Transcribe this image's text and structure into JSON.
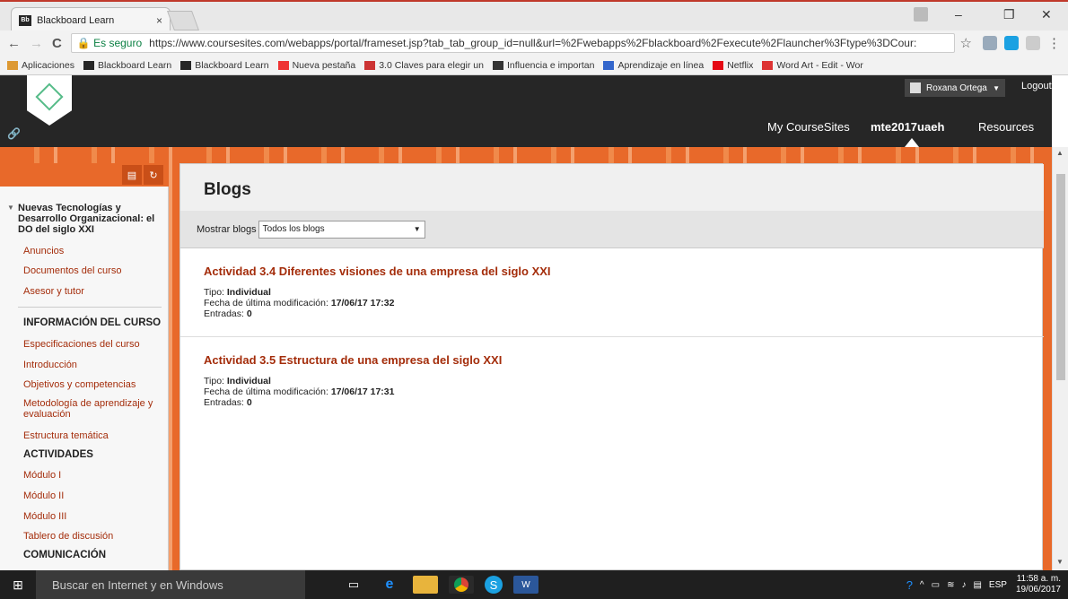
{
  "browser": {
    "tab_title": "Blackboard Learn",
    "tab_favicon": "Bb",
    "tab_close": "×",
    "minimize": "–",
    "maximize": "❐",
    "close": "✕",
    "back": "←",
    "forward": "→",
    "reload": "C",
    "secure_label": "🔒 Es seguro",
    "url": "https://www.coursesites.com/webapps/portal/frameset.jsp?tab_tab_group_id=null&url=%2Fwebapps%2Fblackboard%2Fexecute%2Flauncher%3Ftype%3DCour:",
    "star": "☆",
    "menu": "⋮"
  },
  "bookmarks": [
    {
      "label": "Aplicaciones",
      "color": "#d93"
    },
    {
      "label": "Blackboard Learn",
      "color": "#262626"
    },
    {
      "label": "Blackboard Learn",
      "color": "#262626"
    },
    {
      "label": "Nueva pestaña",
      "color": "#e33"
    },
    {
      "label": "3.0 Claves para elegir un",
      "color": "#c33"
    },
    {
      "label": "Influencia e importan",
      "color": "#333"
    },
    {
      "label": "Aprendizaje en línea",
      "color": "#36c"
    },
    {
      "label": "Netflix",
      "color": "#e50914"
    },
    {
      "label": "Word Art - Edit - Wor",
      "color": "#d33"
    }
  ],
  "header": {
    "user_name": "Roxana Ortega",
    "logout": "Logout",
    "link_icon": "🔗",
    "nav": {
      "my_coursesites": "My CourseSites",
      "course": "mte2017uaeh",
      "resources": "Resources"
    }
  },
  "sidebar": {
    "course_title": "Nuevas Tecnologías y Desarrollo Organizacional: el DO del siglo XXI",
    "caret": "▼",
    "links_top": [
      "Anuncios",
      "Documentos del curso",
      "Asesor y tutor"
    ],
    "section_info": "INFORMACIÓN DEL CURSO",
    "links_info": [
      "Especificaciones del curso",
      "Introducción",
      "Objetivos y competencias",
      "Metodología de aprendizaje y evaluación",
      "Estructura temática"
    ],
    "section_act": "ACTIVIDADES",
    "links_act": [
      "Módulo I",
      "Módulo II",
      "Módulo III",
      "Tablero de discusión"
    ],
    "section_com": "COMUNICACIÓN"
  },
  "main": {
    "title": "Blogs",
    "filter_label": "Mostrar blogs",
    "filter_value": "Todos los blogs",
    "blogs": [
      {
        "title": "Actividad 3.4 Diferentes visiones de una empresa del siglo XXI",
        "tipo_label": "Tipo:",
        "tipo": "Individual",
        "fecha_label": "Fecha de última modificación:",
        "fecha": "17/06/17 17:32",
        "entradas_label": "Entradas:",
        "entradas": "0"
      },
      {
        "title": "Actividad 3.5 Estructura de una empresa del siglo XXI",
        "tipo_label": "Tipo:",
        "tipo": "Individual",
        "fecha_label": "Fecha de última modificación:",
        "fecha": "17/06/17 17:31",
        "entradas_label": "Entradas:",
        "entradas": "0"
      }
    ]
  },
  "taskbar": {
    "search_placeholder": "Buscar en Internet y en Windows",
    "lang": "ESP",
    "time": "11:58 a. m.",
    "date": "19/06/2017"
  },
  "colors": {
    "accent": "#a42d0b",
    "pattern": "#e8692a",
    "header": "#262626"
  }
}
